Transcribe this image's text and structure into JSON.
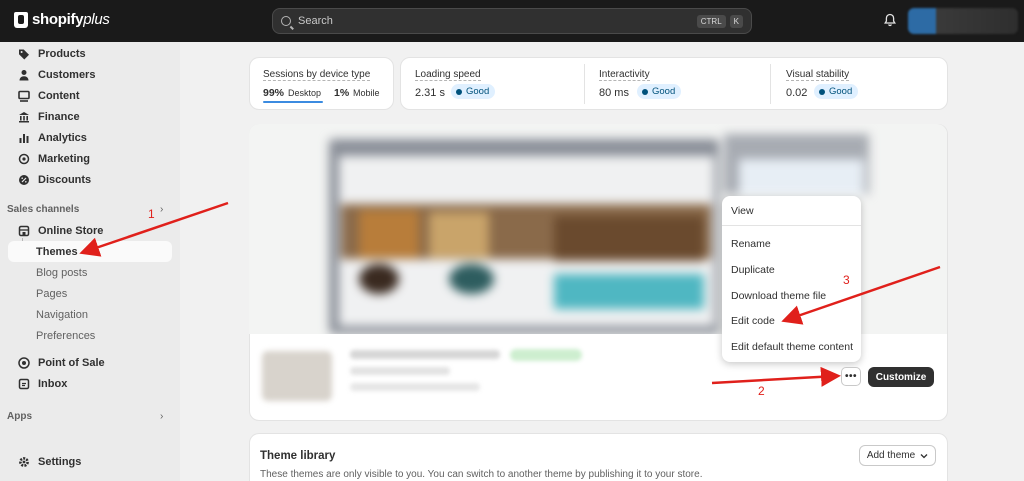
{
  "brand": {
    "name": "shopify",
    "suffix": "plus"
  },
  "search": {
    "placeholder": "Search",
    "kbd1": "CTRL",
    "kbd2": "K"
  },
  "sidebar": {
    "items": [
      {
        "label": "Products",
        "icon": "tag-icon"
      },
      {
        "label": "Customers",
        "icon": "person-icon"
      },
      {
        "label": "Content",
        "icon": "content-icon"
      },
      {
        "label": "Finance",
        "icon": "bank-icon"
      },
      {
        "label": "Analytics",
        "icon": "bar-chart-icon"
      },
      {
        "label": "Marketing",
        "icon": "target-icon"
      },
      {
        "label": "Discounts",
        "icon": "discount-icon"
      }
    ],
    "sales_channels_title": "Sales channels",
    "online_store": "Online Store",
    "sub_items": [
      "Themes",
      "Blog posts",
      "Pages",
      "Navigation",
      "Preferences"
    ],
    "point_of_sale": "Point of Sale",
    "inbox": "Inbox",
    "apps_title": "Apps",
    "settings": "Settings"
  },
  "metrics": {
    "sessions": {
      "label": "Sessions by device type",
      "desktop_pct": "99%",
      "desktop_label": "Desktop",
      "mobile_pct": "1%",
      "mobile_label": "Mobile"
    },
    "loading": {
      "label": "Loading speed",
      "value": "2.31 s",
      "badge": "Good"
    },
    "interactivity": {
      "label": "Interactivity",
      "value": "80 ms",
      "badge": "Good"
    },
    "stability": {
      "label": "Visual stability",
      "value": "0.02",
      "badge": "Good"
    }
  },
  "menu": {
    "items": [
      "View",
      "Rename",
      "Duplicate",
      "Download theme file",
      "Edit code",
      "Edit default theme content"
    ]
  },
  "actions": {
    "more": "•••",
    "customize": "Customize"
  },
  "library": {
    "title": "Theme library",
    "description": "These themes are only visible to you. You can switch to another theme by publishing it to your store.",
    "add_theme": "Add theme"
  },
  "annotations": {
    "a1": "1",
    "a2": "2",
    "a3": "3"
  },
  "colors": {
    "accent_badge": "#e0f0ff",
    "annotation": "#e0201b",
    "topbar": "#1a1a1a"
  }
}
